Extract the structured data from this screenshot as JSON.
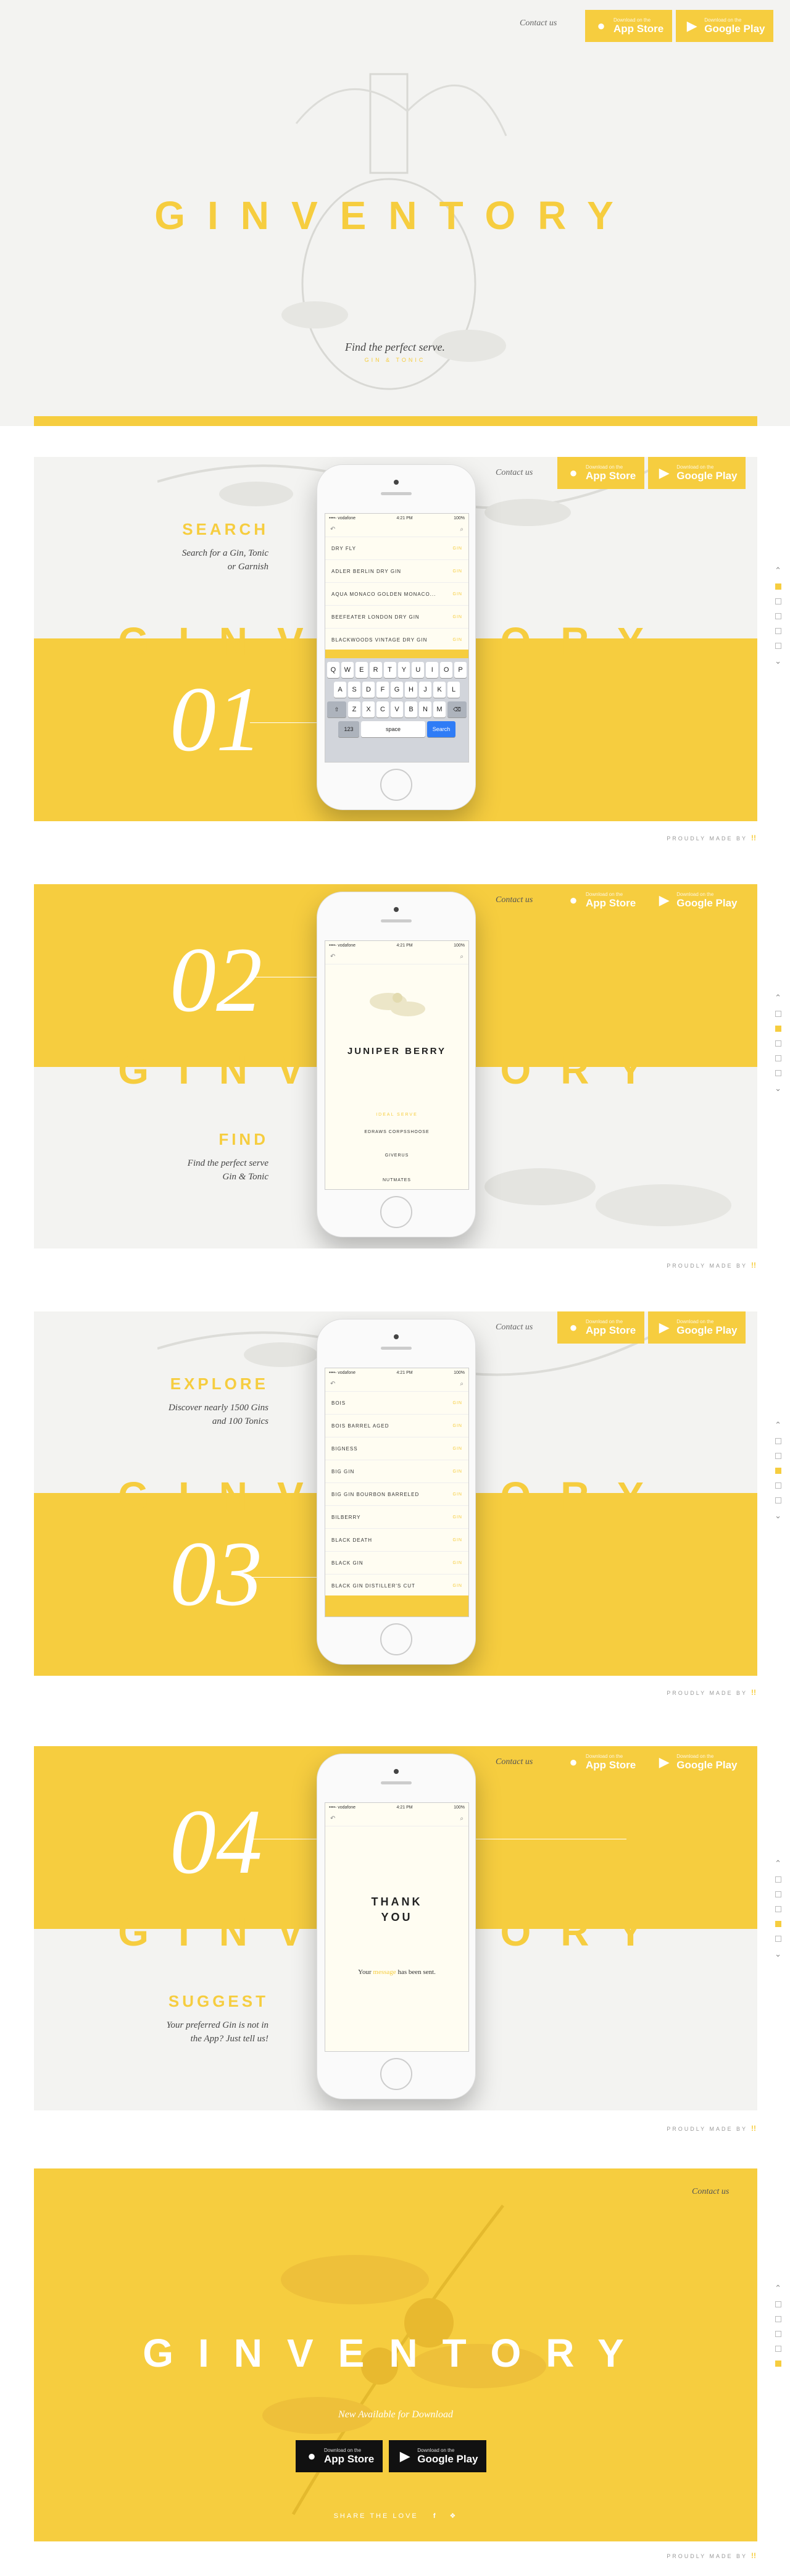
{
  "brand": "GINVENTORY",
  "contact_label": "Contact us",
  "stores": {
    "app_store_small": "Download on the",
    "app_store_big": "App Store",
    "google_small": "Download on the",
    "google_big": "Google Play"
  },
  "hero": {
    "tagline": "Find the perfect serve.",
    "sub": "GIN & TONIC"
  },
  "made_by_label": "PROUDLY MADE BY",
  "made_by_mark": "!!",
  "sections": [
    {
      "number": "01",
      "title": "SEARCH",
      "text_line1": "Search for a Gin, Tonic",
      "text_line2": "or Garnish"
    },
    {
      "number": "02",
      "title": "FIND",
      "text_line1": "Find the perfect serve",
      "text_line2": "Gin & Tonic"
    },
    {
      "number": "03",
      "title": "EXPLORE",
      "text_line1": "Discover nearly 1500 Gins",
      "text_line2": "and 100 Tonics"
    },
    {
      "number": "04",
      "title": "SUGGEST",
      "text_line1": "Your preferred Gin is not in",
      "text_line2": "the App? Just tell us!"
    }
  ],
  "phone_status": {
    "carrier": "••••◦ vodafone",
    "time": "4:21 PM",
    "battery": "100%"
  },
  "search_screen": {
    "rows": [
      {
        "name": "DRY FLY",
        "tag": "GIN"
      },
      {
        "name": "ADLER BERLIN DRY GIN",
        "tag": "GIN"
      },
      {
        "name": "AQUA MONACO GOLDEN MONACO...",
        "tag": "GIN"
      },
      {
        "name": "BEEFEATER LONDON DRY GIN",
        "tag": "GIN"
      },
      {
        "name": "BLACKWOODS VINTAGE DRY GIN",
        "tag": "GIN"
      }
    ],
    "keyboard": {
      "row1": [
        "Q",
        "W",
        "E",
        "R",
        "T",
        "Y",
        "U",
        "I",
        "O",
        "P"
      ],
      "row2": [
        "A",
        "S",
        "D",
        "F",
        "G",
        "H",
        "J",
        "K",
        "L"
      ],
      "row3": [
        "Z",
        "X",
        "C",
        "V",
        "B",
        "N",
        "M"
      ],
      "num_key": "123",
      "space_key": "space",
      "search_key": "Search"
    }
  },
  "find_screen": {
    "title": "JUNIPER BERRY",
    "subtitle": "IDEAL SERVE",
    "rows": [
      "EDRAWS CORPSSHOOSE",
      "GIVERUS",
      "NUTMATES"
    ]
  },
  "explore_screen": {
    "rows": [
      {
        "name": "BOIS",
        "tag": "GIN"
      },
      {
        "name": "BOIS BARREL AGED",
        "tag": "GIN"
      },
      {
        "name": "BIGNESS",
        "tag": "GIN"
      },
      {
        "name": "BIG GIN",
        "tag": "GIN"
      },
      {
        "name": "BIG GIN BOURBON BARRELED",
        "tag": "GIN"
      },
      {
        "name": "BILBERRY",
        "tag": "GIN"
      },
      {
        "name": "BLACK DEATH",
        "tag": "GIN"
      },
      {
        "name": "BLACK GIN",
        "tag": "GIN"
      },
      {
        "name": "BLACK GIN DISTILLER'S CUT",
        "tag": "GIN"
      }
    ]
  },
  "suggest_screen": {
    "title_line1": "THANK",
    "title_line2": "YOU",
    "msg_pre": "Your",
    "msg_word": "message",
    "msg_post": "has been sent."
  },
  "footer": {
    "available": "New Available for Download",
    "share": "SHARE THE LOVE",
    "app_store_small": "Download on the",
    "app_store_big": "App Store",
    "google_small": "Download on the",
    "google_big": "Google Play"
  },
  "icons": {
    "apple": "apple-icon",
    "play": "play-icon",
    "facebook": "facebook-icon",
    "twitter": "twitter-icon"
  },
  "colors": {
    "accent": "#f6cd3f",
    "grey_bg": "#f3f3f1",
    "text": "#333333"
  }
}
